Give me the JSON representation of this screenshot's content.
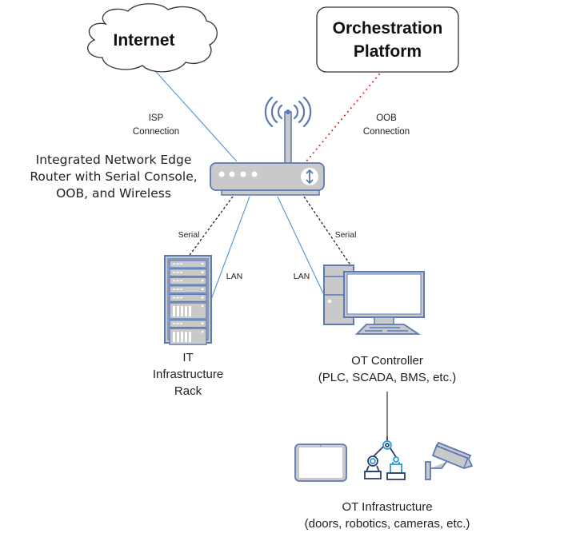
{
  "diagram": {
    "nodes": {
      "internet": {
        "label": "Internet",
        "icon": "cloud-icon"
      },
      "orchestration": {
        "label_line1": "Orchestration",
        "label_line2": "Platform",
        "icon": "rounded-box"
      },
      "router": {
        "label_lines": [
          "Integrated Network Edge",
          "Router with Serial Console,",
          "OOB, and Wireless"
        ],
        "icon": "router-icon"
      },
      "it_rack": {
        "label_lines": [
          "IT",
          "Infrastructure",
          "Rack"
        ],
        "icon": "server-rack-icon"
      },
      "ot_controller": {
        "label_lines": [
          "OT Controller",
          "(PLC, SCADA, BMS, etc.)"
        ],
        "icon": "desktop-computer-icon"
      },
      "ot_infrastructure": {
        "label_lines": [
          "OT Infrastructure",
          "(doors, robotics, cameras, etc.)"
        ],
        "icons": [
          "tablet-icon",
          "robot-arm-icon",
          "security-camera-icon"
        ]
      }
    },
    "edges": {
      "isp": {
        "label_lines": [
          "ISP",
          "Connection"
        ],
        "style": "solid",
        "color": "#5b9bd5"
      },
      "oob": {
        "label_lines": [
          "OOB",
          "Connection"
        ],
        "style": "dotted",
        "color": "#e8201a"
      },
      "serial_it": {
        "label": "Serial",
        "style": "dashed",
        "color": "#222222"
      },
      "lan_it": {
        "label": "LAN",
        "style": "solid",
        "color": "#5b9bd5"
      },
      "lan_ot": {
        "label": "LAN",
        "style": "solid",
        "color": "#5b9bd5"
      },
      "serial_ot": {
        "label": "Serial",
        "style": "dashed",
        "color": "#222222"
      },
      "controller_to_infra": {
        "style": "solid",
        "color": "#333333"
      }
    },
    "colors": {
      "device_fill": "#c9c9c9",
      "device_stroke": "#5a79b5",
      "lan_line": "#5b9bd5",
      "oob_line": "#e8201a",
      "robot_accent": "#2a9ad8",
      "robot_dark": "#2c3e6a"
    }
  }
}
